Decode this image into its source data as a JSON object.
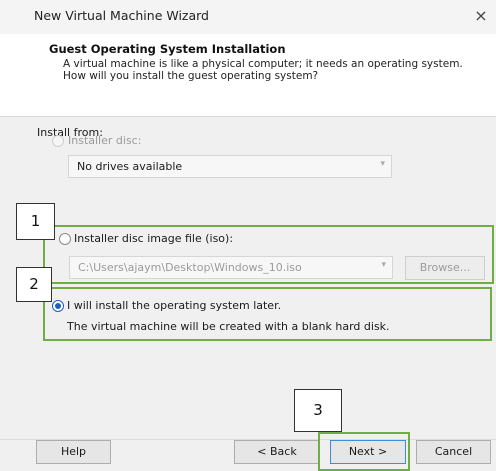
{
  "window": {
    "title": "New Virtual Machine Wizard",
    "close_glyph": "×"
  },
  "header": {
    "title": "Guest Operating System Installation",
    "description": "A virtual machine is like a physical computer; it needs an operating system. How will you install the guest operating system?"
  },
  "install_from_label": "Install from:",
  "option_disc": {
    "label": "Installer disc:",
    "selected": false,
    "enabled": false,
    "drive_value": "No drives available"
  },
  "option_iso": {
    "label": "Installer disc image file (iso):",
    "selected": false,
    "path_value": "C:\\Users\\ajaym\\Desktop\\Windows_10.iso",
    "browse_label": "Browse...",
    "callout_number": "1"
  },
  "option_later": {
    "label": "I will install the operating system later.",
    "note": "The virtual machine will be created with a blank hard disk.",
    "selected": true,
    "callout_number": "2"
  },
  "footer": {
    "help_label": "Help",
    "back_label": "< Back",
    "next_label": "Next >",
    "cancel_label": "Cancel",
    "next_callout_number": "3"
  },
  "colors": {
    "highlight_green": "#70ad47",
    "radio_blue": "#1d5fbf"
  }
}
